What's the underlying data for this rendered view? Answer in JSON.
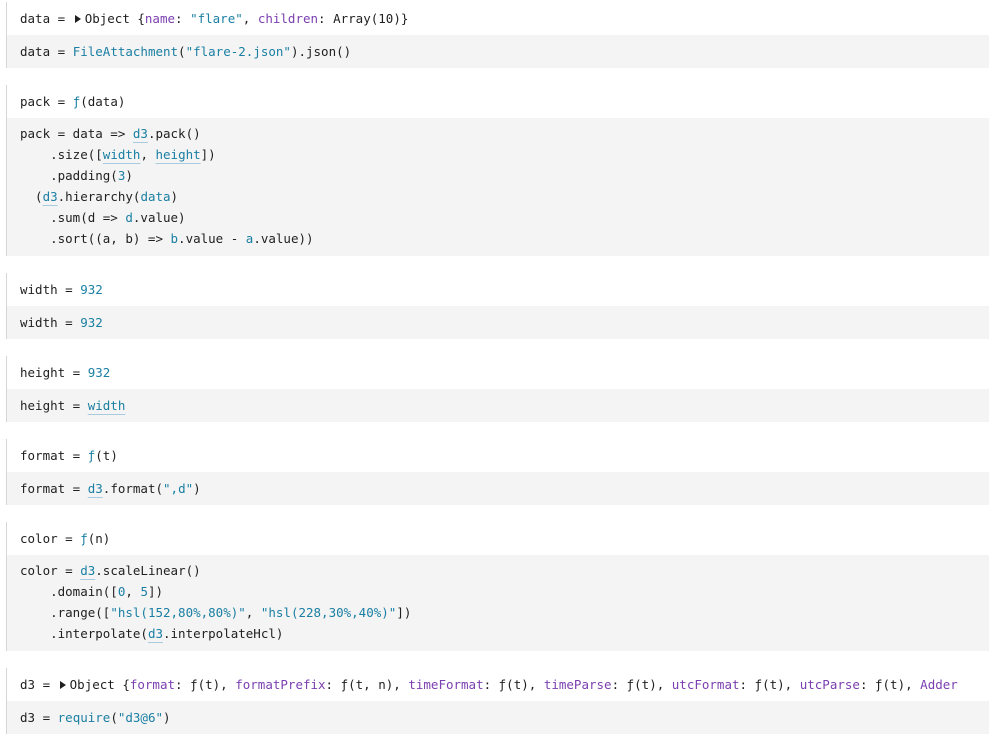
{
  "cells": {
    "data": {
      "output": {
        "name": "data",
        "eq": " = ",
        "type": "Object {",
        "k1": "name",
        "v1": "\"flare\"",
        "k2": "children",
        "v2": "Array(10)",
        "close": "}"
      },
      "source": {
        "name": "data",
        "eq": " = ",
        "fn": "FileAttachment",
        "open": "(",
        "arg": "\"flare-2.json\"",
        "rest": ").json()"
      }
    },
    "pack": {
      "output": {
        "name": "pack",
        "eq": " = ",
        "fn": "ƒ",
        "args": "(data)"
      },
      "source": {
        "l1a": "pack = data => ",
        "l1b": "d3",
        "l1c": ".pack()",
        "l2a": "    .size([",
        "l2b": "width",
        "l2c": ", ",
        "l2d": "height",
        "l2e": "])",
        "l3a": "    .padding(",
        "l3b": "3",
        "l3c": ")",
        "l4a": "  (",
        "l4b": "d3",
        "l4c": ".hierarchy(",
        "l4d": "data",
        "l4e": ")",
        "l5a": "    .sum(d => ",
        "l5b": "d",
        "l5c": ".value)",
        "l6a": "    .sort((a, b) => ",
        "l6b": "b",
        "l6c": ".value - ",
        "l6d": "a",
        "l6e": ".value))"
      }
    },
    "width": {
      "output": {
        "name": "width",
        "eq": " = ",
        "value": "932"
      },
      "source": {
        "name": "width",
        "eq": " = ",
        "value": "932"
      }
    },
    "height": {
      "output": {
        "name": "height",
        "eq": " = ",
        "value": "932"
      },
      "source": {
        "name": "height",
        "eq": " = ",
        "ref": "width"
      }
    },
    "format": {
      "output": {
        "name": "format",
        "eq": " = ",
        "fn": "ƒ",
        "args": "(t)"
      },
      "source": {
        "name": "format",
        "eq": " = ",
        "ref": "d3",
        "mid": ".format(",
        "arg": "\",d\"",
        "close": ")"
      }
    },
    "color": {
      "output": {
        "name": "color",
        "eq": " = ",
        "fn": "ƒ",
        "args": "(n)"
      },
      "source": {
        "l1a": "color = ",
        "l1b": "d3",
        "l1c": ".scaleLinear()",
        "l2a": "    .domain([",
        "l2b": "0",
        "l2c": ", ",
        "l2d": "5",
        "l2e": "])",
        "l3a": "    .range([",
        "l3b": "\"hsl(152,80%,80%)\"",
        "l3c": ", ",
        "l3d": "\"hsl(228,30%,40%)\"",
        "l3e": "])",
        "l4a": "    .interpolate(",
        "l4b": "d3",
        "l4c": ".interpolateHcl)"
      }
    },
    "d3": {
      "output": {
        "name": "d3",
        "eq": " = ",
        "type": "Object {",
        "k1": "format",
        "v1": ": ƒ(t), ",
        "k2": "formatPrefix",
        "v2": ": ƒ(t, n), ",
        "k3": "timeFormat",
        "v3": ": ƒ(t), ",
        "k4": "timeParse",
        "v4": ": ƒ(t), ",
        "k5": "utcFormat",
        "v5": ": ƒ(t), ",
        "k6": "utcParse",
        "v6": ": ƒ(t), ",
        "k7": "Adder"
      },
      "source": {
        "name": "d3",
        "eq": " = ",
        "fn": "require",
        "open": "(",
        "arg": "\"d3@6\"",
        "close": ")"
      }
    }
  }
}
